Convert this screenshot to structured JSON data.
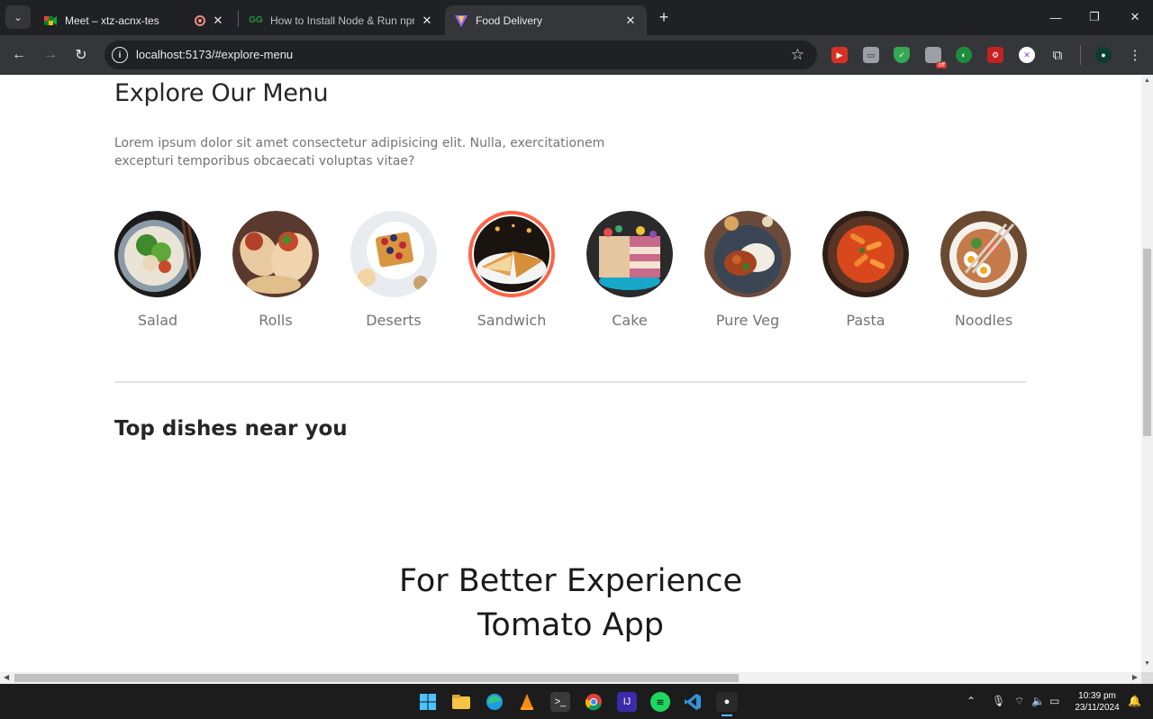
{
  "browser": {
    "tabs": [
      {
        "title": "Meet – xtz-acnx-tes",
        "active": false
      },
      {
        "title": "How to Install Node & Run npm in",
        "active": false
      },
      {
        "title": "Food Delivery",
        "active": true
      }
    ],
    "url": "localhost:5173/#explore-menu"
  },
  "page": {
    "menu_title": "Explore Our Menu",
    "menu_description": "Lorem ipsum dolor sit amet consectetur adipisicing elit. Nulla, exercitationem excepturi temporibus obcaecati voluptas vitae?",
    "menu_items": [
      {
        "label": "Salad",
        "active": false
      },
      {
        "label": "Rolls",
        "active": false
      },
      {
        "label": "Deserts",
        "active": false
      },
      {
        "label": "Sandwich",
        "active": true
      },
      {
        "label": "Cake",
        "active": false
      },
      {
        "label": "Pure Veg",
        "active": false
      },
      {
        "label": "Pasta",
        "active": false
      },
      {
        "label": "Noodles",
        "active": false
      }
    ],
    "top_dishes_title": "Top dishes near you",
    "app_heading_line1": "For Better Experience",
    "app_heading_line2": "Tomato App"
  },
  "taskbar": {
    "time": "10:39 pm",
    "date": "23/11/2024"
  },
  "colors": {
    "accent": "#ff6347",
    "chrome_dark": "#202124",
    "chrome_toolbar": "#35363a"
  }
}
